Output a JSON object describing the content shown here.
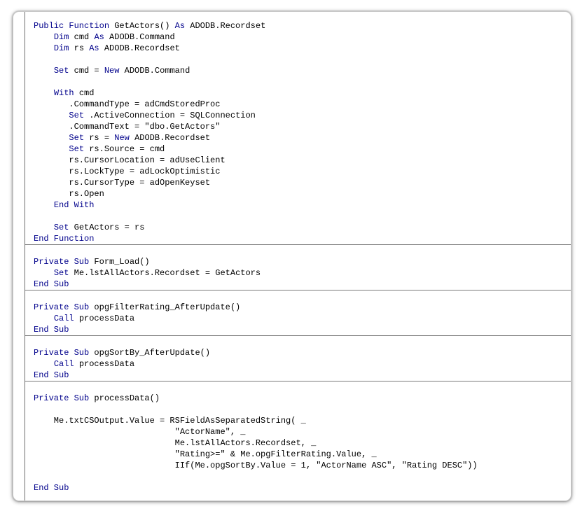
{
  "colors": {
    "keyword": "#00008B",
    "text": "#000000",
    "separator": "#7A7A7A",
    "background": "#FFFFFF"
  },
  "code": {
    "procedures": [
      {
        "name": "GetActors",
        "lines": [
          [
            [
              "k",
              "Public Function "
            ],
            [
              "t",
              "GetActors() "
            ],
            [
              "k",
              "As "
            ],
            [
              "t",
              "ADODB.Recordset"
            ]
          ],
          [
            [
              "t",
              "    "
            ],
            [
              "k",
              "Dim "
            ],
            [
              "t",
              "cmd "
            ],
            [
              "k",
              "As "
            ],
            [
              "t",
              "ADODB.Command"
            ]
          ],
          [
            [
              "t",
              "    "
            ],
            [
              "k",
              "Dim "
            ],
            [
              "t",
              "rs "
            ],
            [
              "k",
              "As "
            ],
            [
              "t",
              "ADODB.Recordset"
            ]
          ],
          [],
          [
            [
              "t",
              "    "
            ],
            [
              "k",
              "Set "
            ],
            [
              "t",
              "cmd = "
            ],
            [
              "k",
              "New "
            ],
            [
              "t",
              "ADODB.Command"
            ]
          ],
          [],
          [
            [
              "t",
              "    "
            ],
            [
              "k",
              "With "
            ],
            [
              "t",
              "cmd"
            ]
          ],
          [
            [
              "t",
              "       .CommandType = adCmdStoredProc"
            ]
          ],
          [
            [
              "t",
              "       "
            ],
            [
              "k",
              "Set "
            ],
            [
              "t",
              ".ActiveConnection = SQLConnection"
            ]
          ],
          [
            [
              "t",
              "       .CommandText = \"dbo.GetActors\""
            ]
          ],
          [
            [
              "t",
              "       "
            ],
            [
              "k",
              "Set "
            ],
            [
              "t",
              "rs = "
            ],
            [
              "k",
              "New "
            ],
            [
              "t",
              "ADODB.Recordset"
            ]
          ],
          [
            [
              "t",
              "       "
            ],
            [
              "k",
              "Set "
            ],
            [
              "t",
              "rs.Source = cmd"
            ]
          ],
          [
            [
              "t",
              "       rs.CursorLocation = adUseClient"
            ]
          ],
          [
            [
              "t",
              "       rs.LockType = adLockOptimistic"
            ]
          ],
          [
            [
              "t",
              "       rs.CursorType = adOpenKeyset"
            ]
          ],
          [
            [
              "t",
              "       rs.Open"
            ]
          ],
          [
            [
              "t",
              "    "
            ],
            [
              "k",
              "End With"
            ]
          ],
          [],
          [
            [
              "t",
              "    "
            ],
            [
              "k",
              "Set "
            ],
            [
              "t",
              "GetActors = rs"
            ]
          ],
          [
            [
              "k",
              "End Function"
            ]
          ]
        ]
      },
      {
        "name": "Form_Load",
        "lines": [
          [],
          [
            [
              "k",
              "Private Sub "
            ],
            [
              "t",
              "Form_Load()"
            ]
          ],
          [
            [
              "t",
              "    "
            ],
            [
              "k",
              "Set "
            ],
            [
              "t",
              "Me.lstAllActors.Recordset = GetActors"
            ]
          ],
          [
            [
              "k",
              "End Sub"
            ]
          ]
        ]
      },
      {
        "name": "opgFilterRating_AfterUpdate",
        "lines": [
          [],
          [
            [
              "k",
              "Private Sub "
            ],
            [
              "t",
              "opgFilterRating_AfterUpdate()"
            ]
          ],
          [
            [
              "t",
              "    "
            ],
            [
              "k",
              "Call "
            ],
            [
              "t",
              "processData"
            ]
          ],
          [
            [
              "k",
              "End Sub"
            ]
          ]
        ]
      },
      {
        "name": "opgSortBy_AfterUpdate",
        "lines": [
          [],
          [
            [
              "k",
              "Private Sub "
            ],
            [
              "t",
              "opgSortBy_AfterUpdate()"
            ]
          ],
          [
            [
              "t",
              "    "
            ],
            [
              "k",
              "Call "
            ],
            [
              "t",
              "processData"
            ]
          ],
          [
            [
              "k",
              "End Sub"
            ]
          ]
        ]
      },
      {
        "name": "processData",
        "lines": [
          [],
          [
            [
              "k",
              "Private Sub "
            ],
            [
              "t",
              "processData()"
            ]
          ],
          [],
          [
            [
              "t",
              "    Me.txtCSOutput.Value = RSFieldAsSeparatedString( _"
            ]
          ],
          [
            [
              "t",
              "                            \"ActorName\", _"
            ]
          ],
          [
            [
              "t",
              "                            Me.lstAllActors.Recordset, _"
            ]
          ],
          [
            [
              "t",
              "                            \"Rating>=\" & Me.opgFilterRating.Value, _"
            ]
          ],
          [
            [
              "t",
              "                            IIf(Me.opgSortBy.Value = 1, \"ActorName ASC\", \"Rating DESC\"))"
            ]
          ],
          [],
          [
            [
              "k",
              "End Sub"
            ]
          ]
        ]
      }
    ]
  }
}
